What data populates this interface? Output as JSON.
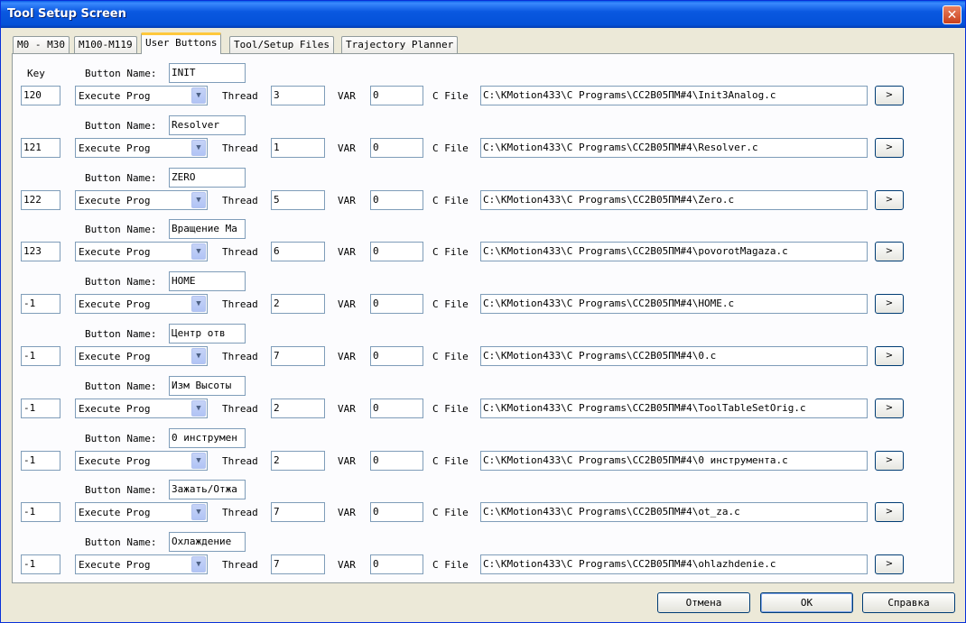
{
  "window": {
    "title": "Tool Setup Screen",
    "close_glyph": "✕"
  },
  "tabs": [
    {
      "label": "M0 - M30"
    },
    {
      "label": "M100-M119"
    },
    {
      "label": "User Buttons"
    },
    {
      "label": "Tool/Setup Files"
    },
    {
      "label": "Trajectory Planner"
    }
  ],
  "labels": {
    "key": "Key",
    "button_name": "Button Name:",
    "thread": "Thread",
    "var": "VAR",
    "c_file": "C File",
    "browse": ">"
  },
  "rows": [
    {
      "key": "120",
      "name": "INIT",
      "action": "Execute Prog",
      "thread": "3",
      "var": "0",
      "file": "C:\\KMotion433\\C Programs\\CC2B05ПМ#4\\Init3Analog.c"
    },
    {
      "key": "121",
      "name": "Resolver",
      "action": "Execute Prog",
      "thread": "1",
      "var": "0",
      "file": "C:\\KMotion433\\C Programs\\CC2B05ПМ#4\\Resolver.c"
    },
    {
      "key": "122",
      "name": "ZERO",
      "action": "Execute Prog",
      "thread": "5",
      "var": "0",
      "file": "C:\\KMotion433\\C Programs\\CC2B05ПМ#4\\Zero.c"
    },
    {
      "key": "123",
      "name": "Вращение Ма",
      "action": "Execute Prog",
      "thread": "6",
      "var": "0",
      "file": "C:\\KMotion433\\C Programs\\CC2B05ПМ#4\\povorotMagaza.c"
    },
    {
      "key": "-1",
      "name": "HOME",
      "action": "Execute Prog",
      "thread": "2",
      "var": "0",
      "file": "C:\\KMotion433\\C Programs\\CC2B05ПМ#4\\HOME.c"
    },
    {
      "key": "-1",
      "name": "Центр отв",
      "action": "Execute Prog",
      "thread": "7",
      "var": "0",
      "file": "C:\\KMotion433\\C Programs\\CC2B05ПМ#4\\0.c"
    },
    {
      "key": "-1",
      "name": "Изм Высоты",
      "action": "Execute Prog",
      "thread": "2",
      "var": "0",
      "file": "C:\\KMotion433\\C Programs\\CC2B05ПМ#4\\ToolTableSetOrig.c"
    },
    {
      "key": "-1",
      "name": "0 инструмен",
      "action": "Execute Prog",
      "thread": "2",
      "var": "0",
      "file": "C:\\KMotion433\\C Programs\\CC2B05ПМ#4\\0 инструмента.c"
    },
    {
      "key": "-1",
      "name": "Зажать/Отжа",
      "action": "Execute Prog",
      "thread": "7",
      "var": "0",
      "file": "C:\\KMotion433\\C Programs\\CC2B05ПМ#4\\ot_za.c"
    },
    {
      "key": "-1",
      "name": "Охлаждение",
      "action": "Execute Prog",
      "thread": "7",
      "var": "0",
      "file": "C:\\KMotion433\\C Programs\\CC2B05ПМ#4\\ohlazhdenie.c"
    }
  ],
  "footer": {
    "cancel": "Отмена",
    "ok": "OK",
    "help": "Справка"
  }
}
